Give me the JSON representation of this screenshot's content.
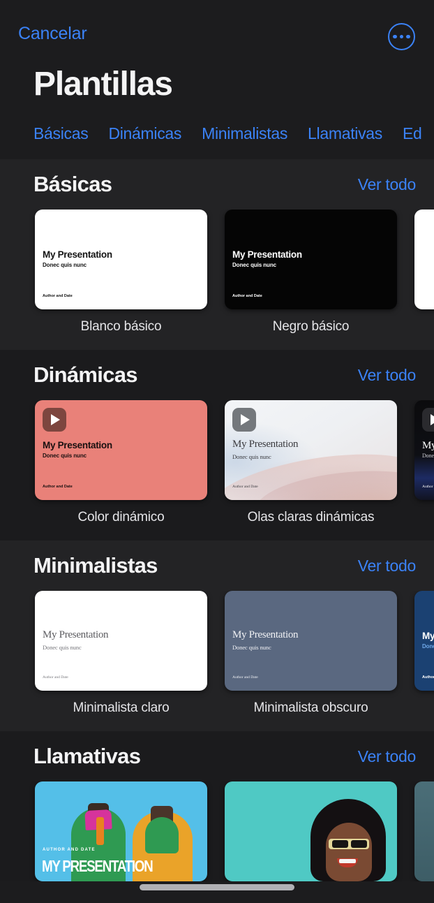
{
  "navbar": {
    "cancel_label": "Cancelar",
    "more_icon": "ellipsis-circle-icon",
    "accent_color": "#3b82f6"
  },
  "header": {
    "title": "Plantillas"
  },
  "tabs": [
    {
      "label": "Básicas"
    },
    {
      "label": "Dinámicas"
    },
    {
      "label": "Minimalistas"
    },
    {
      "label": "Llamativas"
    },
    {
      "label": "Ed"
    }
  ],
  "slide_text": {
    "title": "My Presentation",
    "subtitle": "Donec quis nunc",
    "author": "Author and Date",
    "photo_title": "MY PRESENTATION",
    "photo_author": "AUTHOR AND DATE"
  },
  "sections": [
    {
      "title": "Básicas",
      "see_all": "Ver todo",
      "cards": [
        {
          "label": "Blanco básico",
          "style": "white"
        },
        {
          "label": "Negro básico",
          "style": "black"
        },
        {
          "label": "",
          "style": "white-partial"
        }
      ]
    },
    {
      "title": "Dinámicas",
      "see_all": "Ver todo",
      "cards": [
        {
          "label": "Color dinámico",
          "style": "coral"
        },
        {
          "label": "Olas claras dinámicas",
          "style": "waves"
        },
        {
          "label": "",
          "style": "darknavy-partial"
        }
      ]
    },
    {
      "title": "Minimalistas",
      "see_all": "Ver todo",
      "cards": [
        {
          "label": "Minimalista claro",
          "style": "min-light"
        },
        {
          "label": "Minimalista obscuro",
          "style": "min-dark"
        },
        {
          "label": "",
          "style": "navy-partial"
        }
      ]
    },
    {
      "title": "Llamativas",
      "see_all": "Ver todo",
      "cards": [
        {
          "label": "",
          "style": "photo1"
        },
        {
          "label": "",
          "style": "photo2"
        },
        {
          "label": "",
          "style": "photo3"
        }
      ]
    }
  ],
  "colors": {
    "background": "#1c1c1e",
    "band_light": "#232325",
    "band_dark": "#1b1b1d",
    "accent": "#3b82f6",
    "text_primary": "#f4f4f5"
  }
}
